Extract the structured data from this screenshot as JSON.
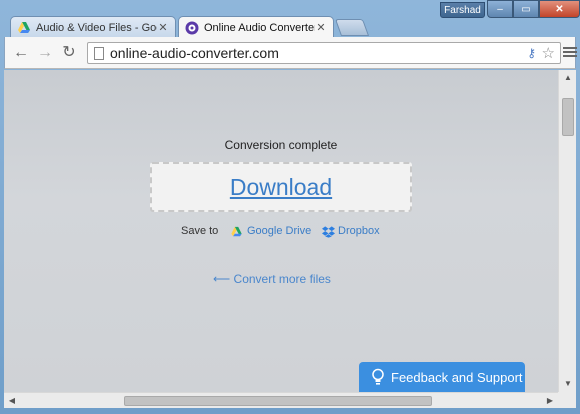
{
  "browser": {
    "user_name": "Farshad",
    "tabs": [
      {
        "label": "Audio & Video Files - Goo",
        "active": false
      },
      {
        "label": "Online Audio Converter -",
        "active": true
      }
    ],
    "url": "online-audio-converter.com",
    "window_controls": {
      "minimize": "–",
      "maximize": "▭",
      "close": "✕"
    }
  },
  "page": {
    "status_text": "Conversion complete",
    "download_label": "Download",
    "save_to_label": "Save to",
    "google_drive_label": "Google Drive",
    "dropbox_label": "Dropbox",
    "convert_more_label": "⟵ Convert more files",
    "feedback_label": "Feedback and Support"
  },
  "colors": {
    "link": "#3a7dc7",
    "feedback_bg": "#3b8fe0",
    "page_bg": "#cfd2d6"
  }
}
